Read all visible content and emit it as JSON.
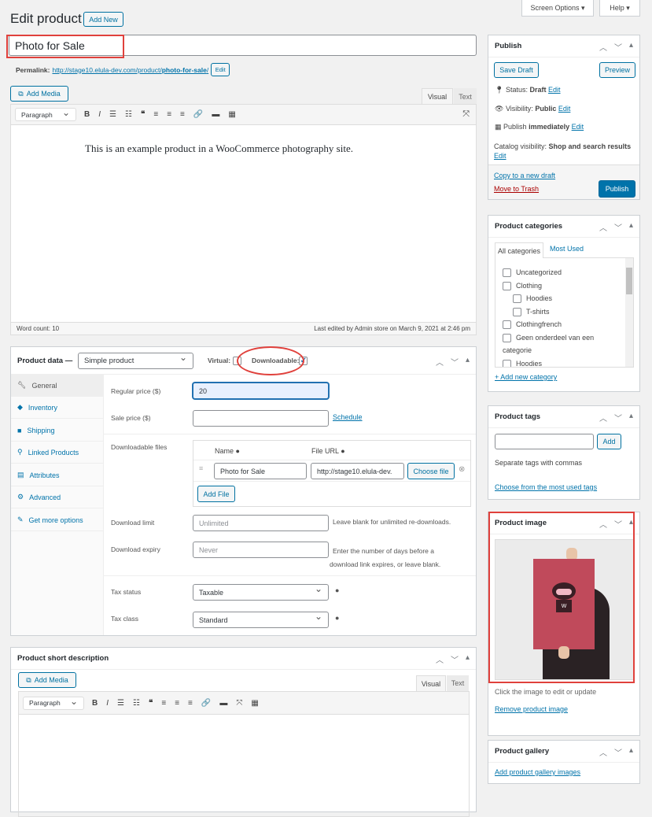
{
  "header": {
    "title": "Edit product",
    "add_new": "Add New",
    "screen_options": "Screen Options ▾",
    "help": "Help ▾"
  },
  "post": {
    "title": "Photo for Sale",
    "permalink_label": "Permalink:",
    "permalink_url": "http://stage10.elula-dev.com/product/",
    "permalink_slug": "photo-for-sale",
    "permalink_end": "/",
    "edit": "Edit"
  },
  "editor": {
    "add_media": "Add Media",
    "tab_visual": "Visual",
    "tab_text": "Text",
    "format": "Paragraph",
    "content": "This is an example product in a WooCommerce photography site.",
    "word_count": "Word count: 10",
    "last_edited": "Last edited by Admin store on March 9, 2021 at 2:46 pm"
  },
  "product_data": {
    "label": "Product data —",
    "type": "Simple product",
    "virtual": "Virtual:",
    "downloadable": "Downloadable:",
    "tabs": [
      {
        "icon": "wrench",
        "label": "General"
      },
      {
        "icon": "tag",
        "label": "Inventory"
      },
      {
        "icon": "truck",
        "label": "Shipping"
      },
      {
        "icon": "link",
        "label": "Linked Products"
      },
      {
        "icon": "table",
        "label": "Attributes"
      },
      {
        "icon": "gear",
        "label": "Advanced"
      },
      {
        "icon": "plugin",
        "label": "Get more options"
      }
    ],
    "regular_price_label": "Regular price ($)",
    "regular_price": "20",
    "sale_price_label": "Sale price ($)",
    "schedule": "Schedule",
    "files_label": "Downloadable files",
    "col_name": "Name",
    "col_url": "File URL",
    "file_name": "Photo for Sale",
    "file_url": "http://stage10.elula-dev.",
    "choose_file": "Choose file",
    "add_file": "Add File",
    "limit_label": "Download limit",
    "limit_ph": "Unlimited",
    "limit_help": "Leave blank for unlimited re-downloads.",
    "expiry_label": "Download expiry",
    "expiry_ph": "Never",
    "expiry_help": "Enter the number of days before a download link expires, or leave blank.",
    "tax_status_label": "Tax status",
    "tax_status": "Taxable",
    "tax_class_label": "Tax class",
    "tax_class": "Standard"
  },
  "short_desc": {
    "title": "Product short description",
    "add_media": "Add Media",
    "tab_visual": "Visual",
    "tab_text": "Text",
    "format": "Paragraph"
  },
  "publish": {
    "title": "Publish",
    "save_draft": "Save Draft",
    "preview": "Preview",
    "status_label": "Status:",
    "status": "Draft",
    "visibility_label": "Visibility:",
    "visibility": "Public",
    "publish_label": "Publish",
    "publish_when": "immediately",
    "catalog_label": "Catalog visibility:",
    "catalog": "Shop and search results",
    "edit": "Edit",
    "copy": "Copy to a new draft",
    "trash": "Move to Trash",
    "publish_btn": "Publish"
  },
  "categories": {
    "title": "Product categories",
    "tab_all": "All categories",
    "tab_most": "Most Used",
    "items": [
      "Uncategorized",
      "Clothing",
      "Hoodies",
      "T-shirts",
      "Clothingfrench",
      "Geen onderdeel van een",
      "categorie",
      "Hoodies"
    ],
    "add": "+ Add new category"
  },
  "tags": {
    "title": "Product tags",
    "add": "Add",
    "help": "Separate tags with commas",
    "choose": "Choose from the most used tags"
  },
  "image": {
    "title": "Product image",
    "hint": "Click the image to edit or update",
    "remove": "Remove product image",
    "poster_letter": "W"
  },
  "gallery": {
    "title": "Product gallery",
    "add": "Add product gallery images"
  }
}
